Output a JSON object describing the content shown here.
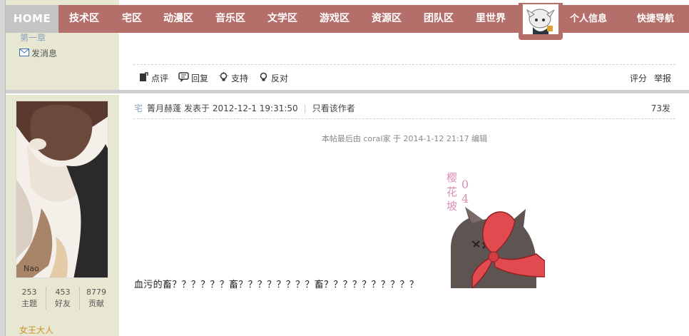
{
  "nav": {
    "home": "HOME",
    "items": [
      "技术区",
      "宅区",
      "动漫区",
      "音乐区",
      "文学区",
      "游戏区",
      "资源区",
      "团队区",
      "里世界"
    ],
    "profile": "个人信息",
    "quick_nav": "快捷导航"
  },
  "prev_post": {
    "chapter_text": "第一章",
    "send_message": "发消息",
    "actions": [
      "点评",
      "回复",
      "支持",
      "反对"
    ],
    "right_actions": [
      "评分",
      "举报"
    ]
  },
  "author": {
    "stats": [
      {
        "value": "253",
        "label": "主题"
      },
      {
        "value": "453",
        "label": "好友"
      },
      {
        "value": "8779",
        "label": "贡献"
      }
    ],
    "title": "女王大人",
    "avatar_caption": "Nao"
  },
  "post": {
    "online_tag": "宅",
    "author_name": "箐月赫蓬",
    "posted_at": "发表于 2012-12-1 19:31:50",
    "only_author": "只看该作者",
    "floor": "73发",
    "edit_note": "本帖最后由 coral家 于 2014-1-12 21:17 编辑",
    "sticker_text": [
      "樱花坡",
      "04"
    ],
    "body": "血污的畜？？？？？？畜？？？？？？？？畜？？？？？？？？？？"
  },
  "colors": {
    "nav_bg": "#b56f6b",
    "sidebar_bg": "#e8e8d2",
    "title_gold": "#c9902c",
    "link_blue": "#8ba0c0"
  }
}
